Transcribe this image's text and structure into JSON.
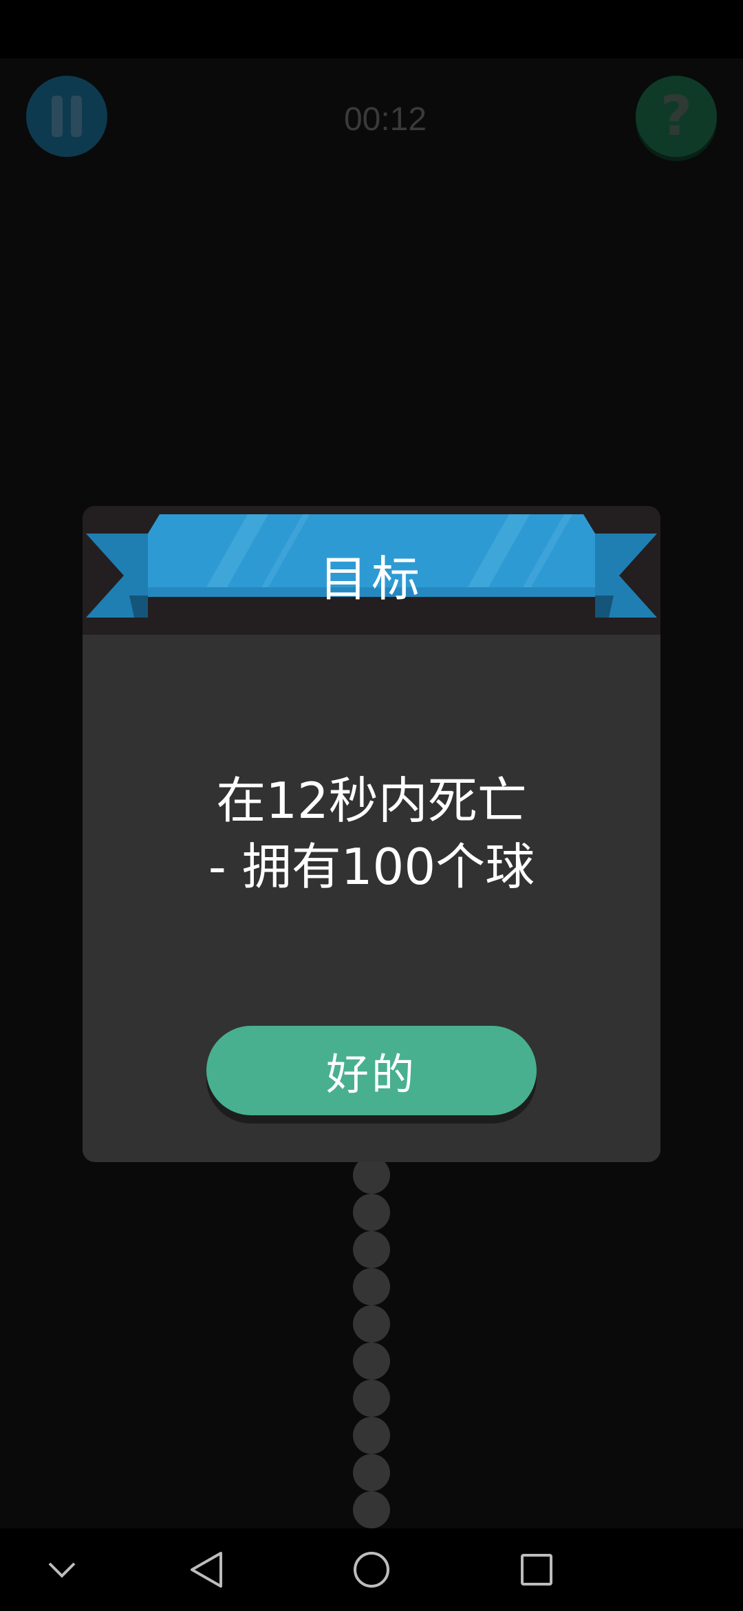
{
  "hud": {
    "timer": "00:12",
    "pause_icon": "pause-icon",
    "help_glyph": "?"
  },
  "dialog": {
    "title": "目标",
    "message_line1": "在12秒内死亡",
    "message_line2": "- 拥有100个球",
    "ok_label": "好的"
  },
  "colors": {
    "ribbon": "#2e9ad3",
    "ok_button": "#48b08e",
    "dialog_bg": "#323232"
  },
  "navigation": {
    "icons": [
      "chevron-down-icon",
      "back-icon",
      "home-icon",
      "recents-icon"
    ]
  }
}
